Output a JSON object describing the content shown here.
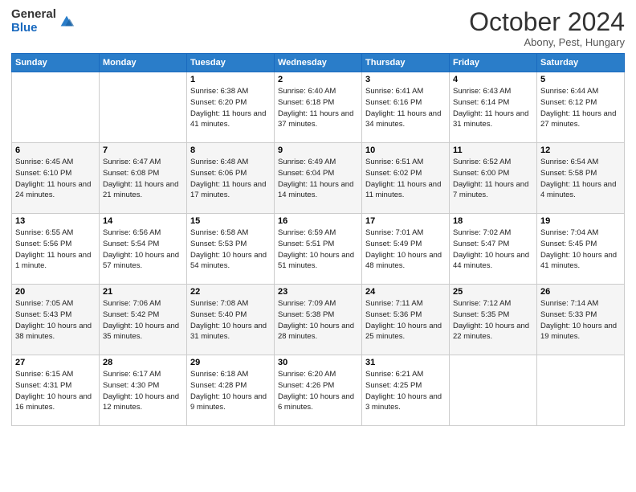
{
  "header": {
    "logo_line1": "General",
    "logo_line2": "Blue",
    "month": "October 2024",
    "location": "Abony, Pest, Hungary"
  },
  "days_of_week": [
    "Sunday",
    "Monday",
    "Tuesday",
    "Wednesday",
    "Thursday",
    "Friday",
    "Saturday"
  ],
  "weeks": [
    [
      {
        "num": "",
        "detail": ""
      },
      {
        "num": "",
        "detail": ""
      },
      {
        "num": "1",
        "detail": "Sunrise: 6:38 AM\nSunset: 6:20 PM\nDaylight: 11 hours and 41 minutes."
      },
      {
        "num": "2",
        "detail": "Sunrise: 6:40 AM\nSunset: 6:18 PM\nDaylight: 11 hours and 37 minutes."
      },
      {
        "num": "3",
        "detail": "Sunrise: 6:41 AM\nSunset: 6:16 PM\nDaylight: 11 hours and 34 minutes."
      },
      {
        "num": "4",
        "detail": "Sunrise: 6:43 AM\nSunset: 6:14 PM\nDaylight: 11 hours and 31 minutes."
      },
      {
        "num": "5",
        "detail": "Sunrise: 6:44 AM\nSunset: 6:12 PM\nDaylight: 11 hours and 27 minutes."
      }
    ],
    [
      {
        "num": "6",
        "detail": "Sunrise: 6:45 AM\nSunset: 6:10 PM\nDaylight: 11 hours and 24 minutes."
      },
      {
        "num": "7",
        "detail": "Sunrise: 6:47 AM\nSunset: 6:08 PM\nDaylight: 11 hours and 21 minutes."
      },
      {
        "num": "8",
        "detail": "Sunrise: 6:48 AM\nSunset: 6:06 PM\nDaylight: 11 hours and 17 minutes."
      },
      {
        "num": "9",
        "detail": "Sunrise: 6:49 AM\nSunset: 6:04 PM\nDaylight: 11 hours and 14 minutes."
      },
      {
        "num": "10",
        "detail": "Sunrise: 6:51 AM\nSunset: 6:02 PM\nDaylight: 11 hours and 11 minutes."
      },
      {
        "num": "11",
        "detail": "Sunrise: 6:52 AM\nSunset: 6:00 PM\nDaylight: 11 hours and 7 minutes."
      },
      {
        "num": "12",
        "detail": "Sunrise: 6:54 AM\nSunset: 5:58 PM\nDaylight: 11 hours and 4 minutes."
      }
    ],
    [
      {
        "num": "13",
        "detail": "Sunrise: 6:55 AM\nSunset: 5:56 PM\nDaylight: 11 hours and 1 minute."
      },
      {
        "num": "14",
        "detail": "Sunrise: 6:56 AM\nSunset: 5:54 PM\nDaylight: 10 hours and 57 minutes."
      },
      {
        "num": "15",
        "detail": "Sunrise: 6:58 AM\nSunset: 5:53 PM\nDaylight: 10 hours and 54 minutes."
      },
      {
        "num": "16",
        "detail": "Sunrise: 6:59 AM\nSunset: 5:51 PM\nDaylight: 10 hours and 51 minutes."
      },
      {
        "num": "17",
        "detail": "Sunrise: 7:01 AM\nSunset: 5:49 PM\nDaylight: 10 hours and 48 minutes."
      },
      {
        "num": "18",
        "detail": "Sunrise: 7:02 AM\nSunset: 5:47 PM\nDaylight: 10 hours and 44 minutes."
      },
      {
        "num": "19",
        "detail": "Sunrise: 7:04 AM\nSunset: 5:45 PM\nDaylight: 10 hours and 41 minutes."
      }
    ],
    [
      {
        "num": "20",
        "detail": "Sunrise: 7:05 AM\nSunset: 5:43 PM\nDaylight: 10 hours and 38 minutes."
      },
      {
        "num": "21",
        "detail": "Sunrise: 7:06 AM\nSunset: 5:42 PM\nDaylight: 10 hours and 35 minutes."
      },
      {
        "num": "22",
        "detail": "Sunrise: 7:08 AM\nSunset: 5:40 PM\nDaylight: 10 hours and 31 minutes."
      },
      {
        "num": "23",
        "detail": "Sunrise: 7:09 AM\nSunset: 5:38 PM\nDaylight: 10 hours and 28 minutes."
      },
      {
        "num": "24",
        "detail": "Sunrise: 7:11 AM\nSunset: 5:36 PM\nDaylight: 10 hours and 25 minutes."
      },
      {
        "num": "25",
        "detail": "Sunrise: 7:12 AM\nSunset: 5:35 PM\nDaylight: 10 hours and 22 minutes."
      },
      {
        "num": "26",
        "detail": "Sunrise: 7:14 AM\nSunset: 5:33 PM\nDaylight: 10 hours and 19 minutes."
      }
    ],
    [
      {
        "num": "27",
        "detail": "Sunrise: 6:15 AM\nSunset: 4:31 PM\nDaylight: 10 hours and 16 minutes."
      },
      {
        "num": "28",
        "detail": "Sunrise: 6:17 AM\nSunset: 4:30 PM\nDaylight: 10 hours and 12 minutes."
      },
      {
        "num": "29",
        "detail": "Sunrise: 6:18 AM\nSunset: 4:28 PM\nDaylight: 10 hours and 9 minutes."
      },
      {
        "num": "30",
        "detail": "Sunrise: 6:20 AM\nSunset: 4:26 PM\nDaylight: 10 hours and 6 minutes."
      },
      {
        "num": "31",
        "detail": "Sunrise: 6:21 AM\nSunset: 4:25 PM\nDaylight: 10 hours and 3 minutes."
      },
      {
        "num": "",
        "detail": ""
      },
      {
        "num": "",
        "detail": ""
      }
    ]
  ]
}
